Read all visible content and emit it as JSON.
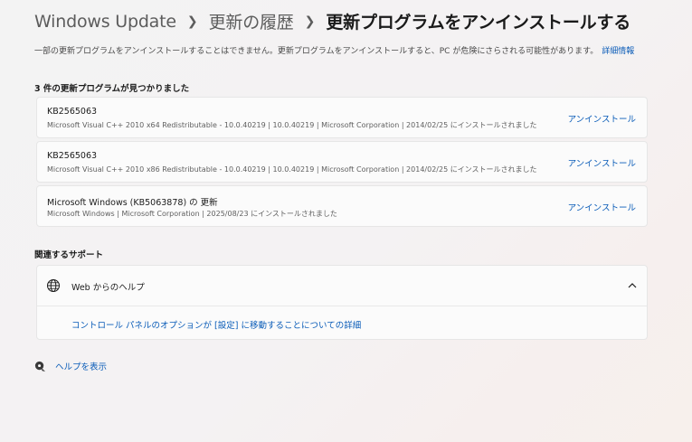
{
  "breadcrumb": {
    "items": [
      "Windows Update",
      "更新の履歴"
    ],
    "current": "更新プログラムをアンインストールする"
  },
  "description": {
    "text": "一部の更新プログラムをアンインストールすることはできません。更新プログラムをアンインストールすると、PC が危険にさらされる可能性があります。",
    "link_label": "詳細情報"
  },
  "updates_heading": "3 件の更新プログラムが見つかりました",
  "updates": [
    {
      "name": "KB2565063",
      "details": "Microsoft Visual C++ 2010  x64 Redistributable - 10.0.40219  |  10.0.40219  |  Microsoft Corporation  |  2014/02/25 にインストールされました",
      "action": "アンインストール"
    },
    {
      "name": "KB2565063",
      "details": "Microsoft Visual C++ 2010  x86 Redistributable - 10.0.40219  |  10.0.40219  |  Microsoft Corporation  |  2014/02/25 にインストールされました",
      "action": "アンインストール"
    },
    {
      "name": "Microsoft Windows (KB5063878) の 更新",
      "details": "Microsoft Windows  |  Microsoft Corporation  |  2025/08/23 にインストールされました",
      "action": "アンインストール"
    }
  ],
  "support": {
    "heading": "関連するサポート",
    "web_help_label": "Web からのヘルプ",
    "link_label": "コントロール パネルのオプションが [設定] に移動することについての詳細"
  },
  "help": {
    "label": "ヘルプを表示"
  },
  "colors": {
    "accent": "#0a5cb8",
    "card_bg": "#fbfbfb",
    "card_border": "#e6e6e6"
  },
  "icons": {
    "support_icon": "globe-icon",
    "expander_icon": "chevron-up-icon",
    "help_icon": "help-chat-icon"
  }
}
